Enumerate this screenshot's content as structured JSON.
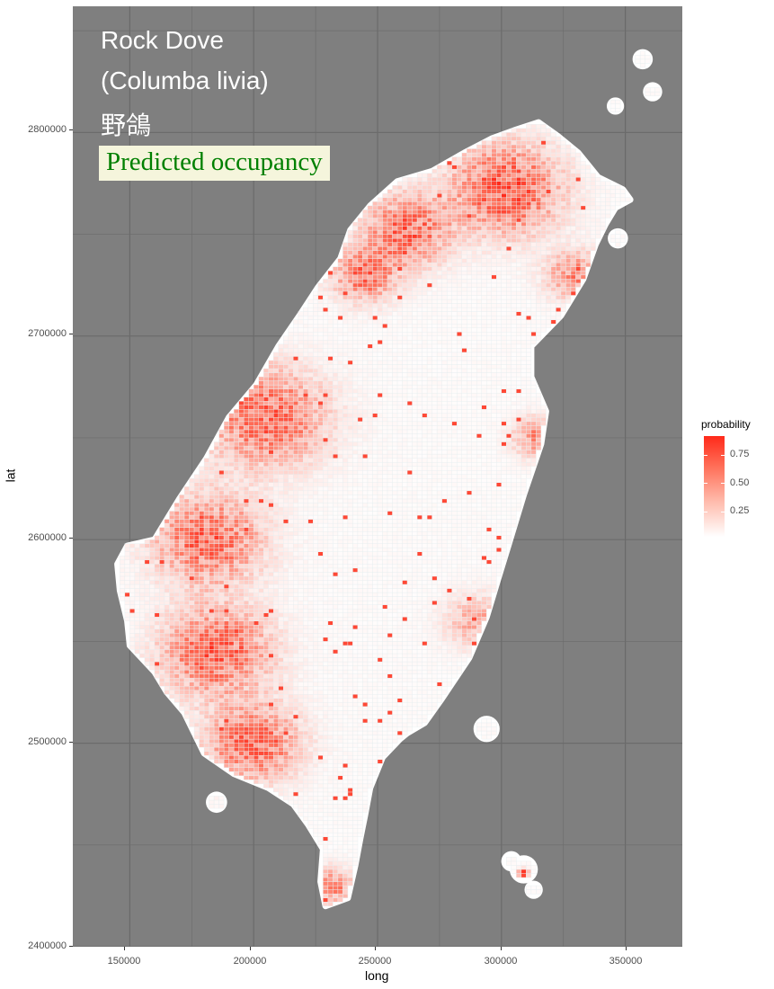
{
  "chart_data": {
    "type": "heatmap",
    "title_lines": [
      "Rock Dove",
      "(Columba livia)",
      "野鴿"
    ],
    "subtitle": "Predicted occupancy",
    "xlabel": "long",
    "ylabel": "lat",
    "xlim": [
      127000,
      373000
    ],
    "ylim": [
      2400000,
      2862000
    ],
    "x_ticks": [
      150000,
      200000,
      250000,
      300000,
      350000
    ],
    "y_ticks": [
      2400000,
      2500000,
      2600000,
      2700000,
      2800000
    ],
    "x_tick_labels": [
      "150000",
      "200000",
      "250000",
      "300000",
      "350000"
    ],
    "y_tick_labels": [
      "2400000",
      "2500000",
      "2600000",
      "2700000",
      "2800000"
    ],
    "grid": true,
    "panel_background": "#7f7f7f",
    "low_color": "#ffffff",
    "high_color": "#ff2a1a",
    "legend": {
      "title": "probability",
      "placement": "right",
      "ticks": [
        0.25,
        0.5,
        0.75
      ],
      "tick_labels": [
        "0.25",
        "0.50",
        "0.75"
      ],
      "range": [
        0.0,
        0.85
      ]
    },
    "main_outline": [
      [
        315000,
        2805000
      ],
      [
        305000,
        2801000
      ],
      [
        296000,
        2797000
      ],
      [
        285000,
        2790000
      ],
      [
        272000,
        2781000
      ],
      [
        258000,
        2776000
      ],
      [
        247000,
        2764000
      ],
      [
        239000,
        2752000
      ],
      [
        235000,
        2738000
      ],
      [
        226000,
        2724000
      ],
      [
        219000,
        2711000
      ],
      [
        210000,
        2695000
      ],
      [
        201000,
        2676000
      ],
      [
        190000,
        2660000
      ],
      [
        181000,
        2640000
      ],
      [
        170000,
        2620000
      ],
      [
        160000,
        2600000
      ],
      [
        149000,
        2597000
      ],
      [
        145000,
        2588000
      ],
      [
        146000,
        2575000
      ],
      [
        149000,
        2560000
      ],
      [
        150000,
        2548000
      ],
      [
        160000,
        2535000
      ],
      [
        165000,
        2525000
      ],
      [
        172000,
        2515000
      ],
      [
        180000,
        2495000
      ],
      [
        192000,
        2485000
      ],
      [
        206000,
        2478000
      ],
      [
        216000,
        2470000
      ],
      [
        222000,
        2460000
      ],
      [
        228000,
        2448000
      ],
      [
        227000,
        2432000
      ],
      [
        229000,
        2420000
      ],
      [
        238000,
        2424000
      ],
      [
        241000,
        2440000
      ],
      [
        243000,
        2453000
      ],
      [
        245000,
        2465000
      ],
      [
        247000,
        2478000
      ],
      [
        252000,
        2493000
      ],
      [
        259000,
        2502000
      ],
      [
        262000,
        2505000
      ],
      [
        269000,
        2510000
      ],
      [
        276000,
        2522000
      ],
      [
        287000,
        2542000
      ],
      [
        294000,
        2562000
      ],
      [
        299000,
        2582000
      ],
      [
        303000,
        2598000
      ],
      [
        309000,
        2622000
      ],
      [
        316000,
        2647000
      ],
      [
        318000,
        2663000
      ],
      [
        312000,
        2680000
      ],
      [
        312000,
        2695000
      ],
      [
        324000,
        2710000
      ],
      [
        333000,
        2728000
      ],
      [
        338000,
        2745000
      ],
      [
        342000,
        2755000
      ],
      [
        346000,
        2763000
      ],
      [
        352000,
        2767000
      ],
      [
        349000,
        2772000
      ],
      [
        339000,
        2778000
      ],
      [
        331000,
        2790000
      ],
      [
        323000,
        2798000
      ]
    ],
    "islands": [
      {
        "name": "penghu",
        "center": [
          294000,
          2507000
        ],
        "radius": 4200
      },
      {
        "name": "liuqiu",
        "center": [
          185000,
          2471000
        ],
        "radius": 3200
      },
      {
        "name": "lanyu",
        "center": [
          309000,
          2438000
        ],
        "radius": 4600
      },
      {
        "name": "green-island-north",
        "center": [
          304000,
          2442000
        ],
        "radius": 3000
      },
      {
        "name": "green-island-south",
        "center": [
          313000,
          2428000
        ],
        "radius": 2600
      },
      {
        "name": "pengjia",
        "center": [
          357000,
          2836000
        ],
        "radius": 3000
      },
      {
        "name": "mianhua",
        "center": [
          361000,
          2820000
        ],
        "radius": 2800
      },
      {
        "name": "huaping",
        "center": [
          346000,
          2813000
        ],
        "radius": 2400
      },
      {
        "name": "guishan",
        "center": [
          347000,
          2748000
        ],
        "radius": 3000
      }
    ],
    "hotspots": [
      {
        "region": "north-coast",
        "center": [
          302000,
          2772000
        ],
        "radius": 20000,
        "probability": 0.7
      },
      {
        "region": "northwest-coast",
        "center": [
          262000,
          2752000
        ],
        "radius": 16000,
        "probability": 0.6
      },
      {
        "region": "taoyuan",
        "center": [
          245000,
          2730000
        ],
        "radius": 12000,
        "probability": 0.55
      },
      {
        "region": "west-central-plain",
        "center": [
          205000,
          2660000
        ],
        "radius": 22000,
        "probability": 0.6
      },
      {
        "region": "changhua-yunlin",
        "center": [
          182000,
          2600000
        ],
        "radius": 20000,
        "probability": 0.6
      },
      {
        "region": "chiayi-tainan",
        "center": [
          185000,
          2545000
        ],
        "radius": 20000,
        "probability": 0.62
      },
      {
        "region": "kaohsiung",
        "center": [
          200000,
          2500000
        ],
        "radius": 17000,
        "probability": 0.6
      },
      {
        "region": "yilan",
        "center": [
          330000,
          2730000
        ],
        "radius": 11000,
        "probability": 0.45
      },
      {
        "region": "hualien-coast",
        "center": [
          315000,
          2650000
        ],
        "radius": 9000,
        "probability": 0.45
      },
      {
        "region": "hengchun",
        "center": [
          231000,
          2430000
        ],
        "radius": 8000,
        "probability": 0.5
      },
      {
        "region": "southeast-coast",
        "center": [
          290000,
          2560000
        ],
        "radius": 12000,
        "probability": 0.3
      },
      {
        "region": "lanyu-peak",
        "center": [
          309000,
          2436000
        ],
        "radius": 1800,
        "probability": 0.9
      }
    ]
  }
}
